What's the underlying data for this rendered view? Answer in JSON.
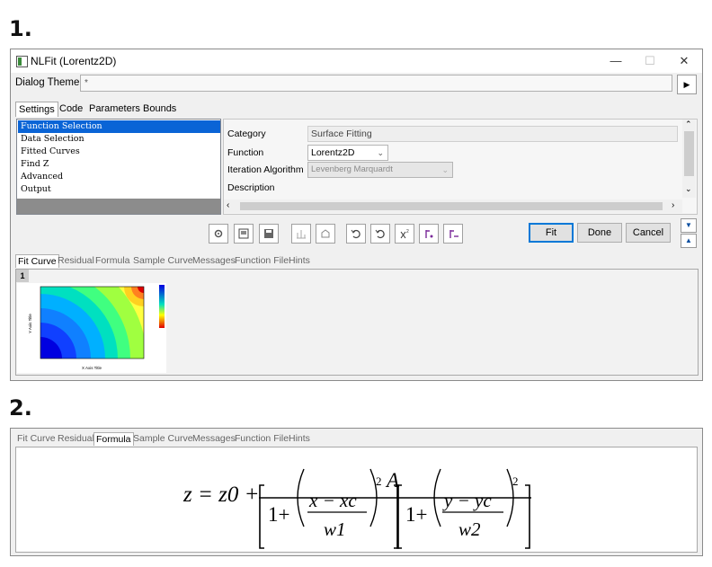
{
  "steps": {
    "one": "1.",
    "two": "2."
  },
  "window": {
    "title": "NLFit (Lorentz2D)",
    "min": "—",
    "max": "☐",
    "close": "✕"
  },
  "dialog_theme": {
    "label": "Dialog Theme",
    "value": "*",
    "arrow": "▶"
  },
  "tabs": [
    "Settings",
    "Code",
    "Parameters",
    "Bounds"
  ],
  "list": [
    "Function Selection",
    "Data Selection",
    "Fitted Curves",
    "Find Z",
    "Advanced",
    "Output"
  ],
  "props": {
    "category_label": "Category",
    "category_value": "Surface Fitting",
    "function_label": "Function",
    "function_value": "Lorentz2D",
    "iteration_label": "Iteration Algorithm",
    "iteration_value": "Levenberg Marquardt",
    "description_label": "Description"
  },
  "buttons": {
    "fit": "Fit",
    "done": "Done",
    "cancel": "Cancel"
  },
  "toolbar_icons": [
    "settings-icon",
    "open-file-icon",
    "save-icon",
    "bar-chart-icon",
    "cube-icon",
    "undo-icon",
    "redo-icon",
    "x2-icon",
    "fit-once-icon",
    "fit-until-done-icon"
  ],
  "bottom_tabs": [
    "Fit Curve",
    "Residual",
    "Formula",
    "Sample Curve",
    "Messages",
    "Function File",
    "Hints"
  ],
  "preview": {
    "tag": "1",
    "x_axis": "X Axis Title",
    "y_axis": "Y Axis Title"
  },
  "formula": {
    "lhs": "z = z0 + ",
    "numerator": "A",
    "x": "x − xc",
    "w1": "w1",
    "y": "y − yc",
    "w2": "w2",
    "one": "1+",
    "exp": "2"
  }
}
